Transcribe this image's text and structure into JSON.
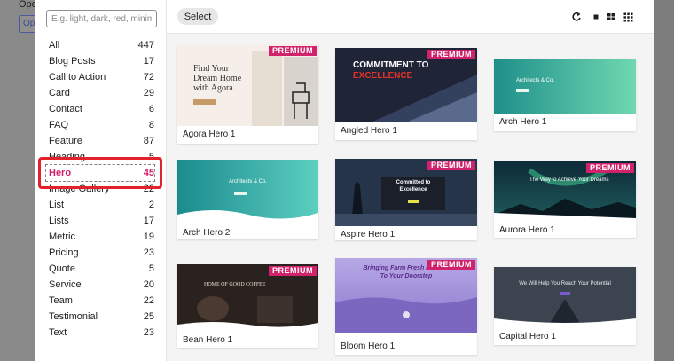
{
  "background": {
    "label": "Ope",
    "button": "Op"
  },
  "search": {
    "placeholder": "E.g. light, dark, red, minimal"
  },
  "categories": [
    {
      "label": "All",
      "count": "447"
    },
    {
      "label": "Blog Posts",
      "count": "17"
    },
    {
      "label": "Call to Action",
      "count": "72"
    },
    {
      "label": "Card",
      "count": "29"
    },
    {
      "label": "Contact",
      "count": "6"
    },
    {
      "label": "FAQ",
      "count": "8"
    },
    {
      "label": "Feature",
      "count": "87"
    },
    {
      "label": "Heading",
      "count": "5"
    },
    {
      "label": "Hero",
      "count": "45"
    },
    {
      "label": "Image Gallery",
      "count": "22"
    },
    {
      "label": "List",
      "count": "2"
    },
    {
      "label": "Lists",
      "count": "17"
    },
    {
      "label": "Metric",
      "count": "19"
    },
    {
      "label": "Pricing",
      "count": "23"
    },
    {
      "label": "Quote",
      "count": "5"
    },
    {
      "label": "Service",
      "count": "20"
    },
    {
      "label": "Team",
      "count": "22"
    },
    {
      "label": "Testimonial",
      "count": "25"
    },
    {
      "label": "Text",
      "count": "23"
    }
  ],
  "toolbar": {
    "select_label": "Select"
  },
  "premium_label": "PREMIUM",
  "cards": {
    "agora": {
      "name": "Agora Hero 1",
      "title_line1": "Find Your",
      "title_line2": "Dream Home",
      "title_line3": "with Agora."
    },
    "angled": {
      "name": "Angled Hero 1",
      "headline_1": "COMMITMENT TO",
      "headline_2": "EXCELLENCE"
    },
    "arch": {
      "name": "Arch Hero 1",
      "headline": "Architects & Co."
    },
    "arch2": {
      "name": "Arch Hero 2",
      "headline": "Architects & Co."
    },
    "aspire": {
      "name": "Aspire Hero 1",
      "headline_1": "Committed to",
      "headline_2": "Excellence"
    },
    "aurora": {
      "name": "Aurora Hero 1",
      "headline": "The Way to Achieve Your Dreams"
    },
    "bean": {
      "name": "Bean Hero 1",
      "headline": "HOME OF GOOD COFFEE"
    },
    "bloom": {
      "name": "Bloom Hero 1",
      "headline_1": "Bringing Farm Fresh Flowers",
      "headline_2": "To Your Doorstep"
    },
    "capital": {
      "name": "Capital Hero 1",
      "headline": "We Will Help You Reach Your Potential"
    }
  },
  "colors": {
    "accent": "#d1236c",
    "highlight": "#e3202b"
  }
}
